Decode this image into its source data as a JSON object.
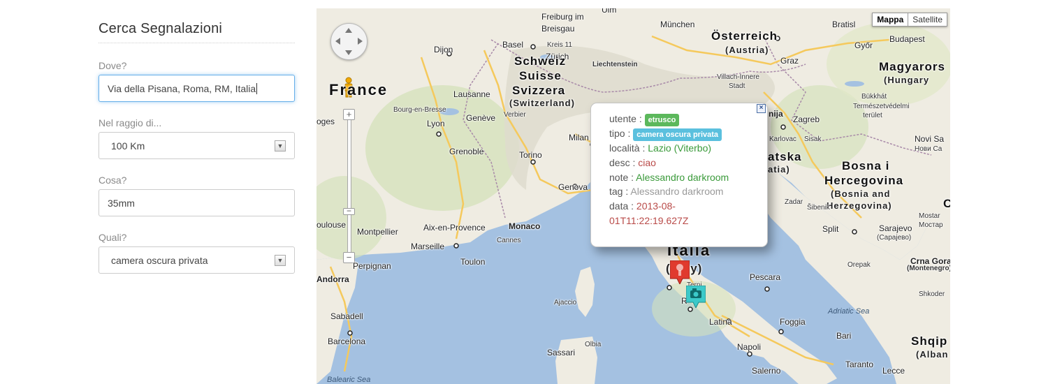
{
  "form": {
    "title": "Cerca Segnalazioni",
    "dove_label": "Dove?",
    "dove_value": "Via della Pisana, Roma, RM, Italia",
    "raggio_label": "Nel raggio di...",
    "raggio_value": "100 Km",
    "cosa_label": "Cosa?",
    "cosa_value": "35mm",
    "quali_label": "Quali?",
    "quali_value": "camera oscura privata"
  },
  "map": {
    "type_buttons": {
      "mappa": "Mappa",
      "satellite": "Satellite"
    },
    "zoom_in": "+",
    "zoom_out": "−",
    "zoom_mid": "−",
    "labels": {
      "ulm": "Ulm",
      "munchen": "München",
      "freiburg": "Freiburg im",
      "breisgau": "Breisgau",
      "basel": "Basel",
      "kreis": "Kreis 11",
      "dijon": "Dijon",
      "zurich": "Zürich",
      "liechtenstein": "Liechtenstein",
      "osterreich": "Österreich",
      "austria": "(Austria)",
      "bratislava": "Bratisl",
      "gyor": "Győr",
      "budapest": "Budapest",
      "magyarors": "Magyarors",
      "hungary": "(Hungary",
      "graz": "Graz",
      "villach": "Villach-Innere",
      "stadt": "Stadt",
      "schweiz": "Schweiz",
      "suisse": "Suisse",
      "svizzera": "Svizzera",
      "switzerland": "(Switzerland)",
      "france": "France",
      "lausanne": "Lausanne",
      "verbier": "Verbier",
      "bourg": "Bourg-en-Bresse",
      "geneve": "Genève",
      "lyon": "Lyon",
      "bukkhat": "Bükkhát",
      "termeszet": "Természetvédelmi",
      "terulet": "terület",
      "zagreb": "Zagreb",
      "karlovac": "Karlovac",
      "sisak": "Sisak",
      "nija": "nija",
      "novisa": "Novi Sa",
      "novisa_cyr": "Нови Са",
      "ogoes": "oges",
      "grenoble": "Grenoble",
      "torino": "Torino",
      "milan": "Milan",
      "genova": "Genova",
      "atska": "atska",
      "atia": "atia)",
      "bosna": "Bosna i",
      "hercegovina": "Hercegovina",
      "bosnia": "(Bosnia and",
      "herzegovina": "Herzegovina)",
      "zadar": "Zadar",
      "sibenik": "Šibenik",
      "split": "Split",
      "sarajevo": "Sarajevo",
      "sarajevo_cyr": "(Сарајево)",
      "mostar": "Mostar",
      "mostar_cyr": "Мостар",
      "oulouse": "oulouse",
      "montpellier": "Montpellier",
      "aix": "Aix-en-Provence",
      "monaco": "Monaco",
      "marseille": "Marseille",
      "cannes": "Cannes",
      "toulon": "Toulon",
      "perpignan": "Perpignan",
      "andorra": "Andorra",
      "italia": "Italia",
      "italy": "(Italy)",
      "terni": "Terni",
      "roma": "R",
      "latina": "Latina",
      "pescara": "Pescara",
      "foggia": "Foggia",
      "orepak": "Orepak",
      "crnagora": "Crna Gora",
      "montenegro": "(Montenegro)",
      "shkoder": "Shkoder",
      "adriatic": "Adriatic Sea",
      "ajaccio": "Ajaccio",
      "sabadell": "Sabadell",
      "barcelona": "Barcelona",
      "olbia": "Olbia",
      "sassari": "Sassari",
      "napoli": "Napoli",
      "salerno": "Salerno",
      "bari": "Bari",
      "taranto": "Taranto",
      "lecce": "Lecce",
      "shqip": "Shqip",
      "alban": "(Alban",
      "balearic": "Balearic Sea",
      "c_edge": "C"
    }
  },
  "info": {
    "utente_key": "utente :",
    "utente_val": "etrusco",
    "tipo_key": "tipo :",
    "tipo_val": "camera oscura privata",
    "localita_key": "località :",
    "localita_val": "Lazio (Viterbo)",
    "desc_key": "desc :",
    "desc_val": "ciao",
    "note_key": "note :",
    "note_val": "Alessandro darkroom",
    "tag_key": "tag :",
    "tag_val": "Alessandro darkroom",
    "data_key": "data :",
    "data_val1": "2013-08-",
    "data_val2": "01T11:22:19.627Z",
    "close": "×"
  },
  "colors": {
    "sea": "#a4c1e1",
    "land": "#efece2",
    "green_land": "#d1dfb6",
    "alps": "#dcdccf",
    "highway": "#f5c95c",
    "border": "#a889a8",
    "marker_red": "#e03a2e",
    "marker_teal": "#3cc9c9"
  }
}
